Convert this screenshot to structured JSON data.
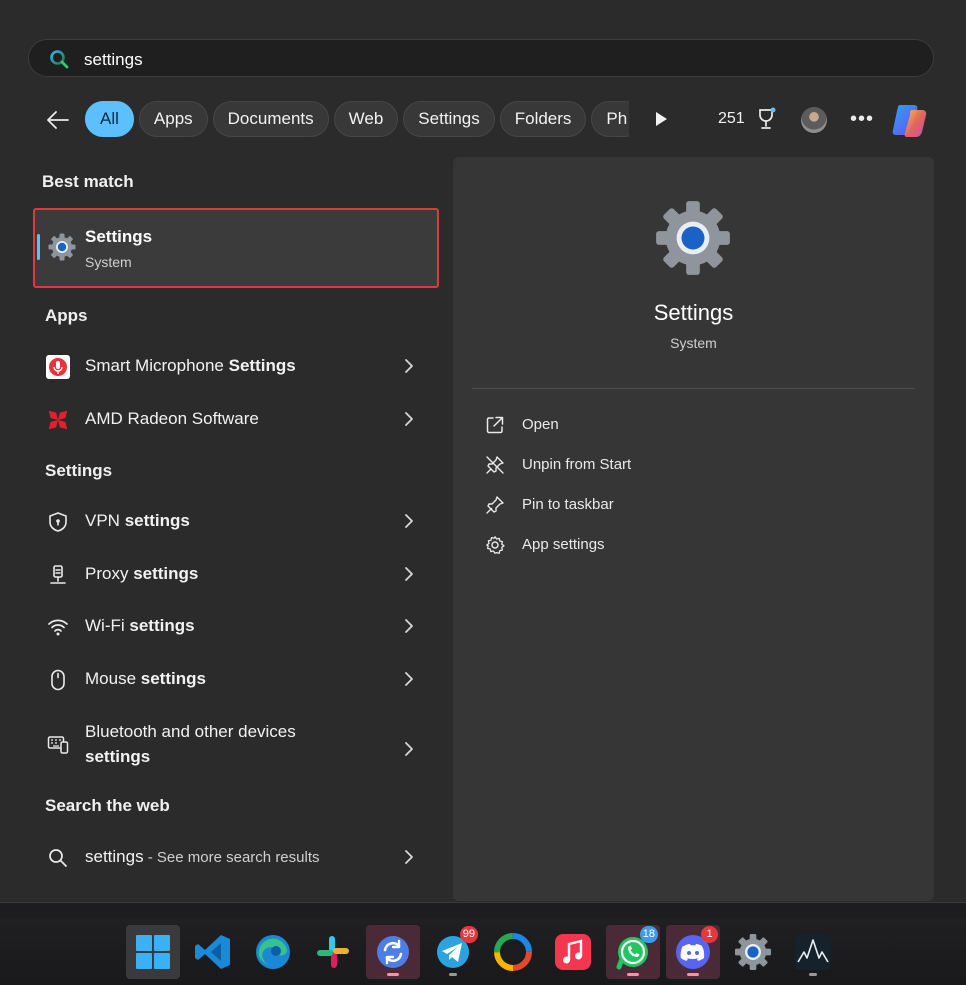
{
  "search": {
    "value": "settings",
    "placeholder": ""
  },
  "filters": [
    "All",
    "Apps",
    "Documents",
    "Web",
    "Settings",
    "Folders",
    "Ph"
  ],
  "header": {
    "points": "251",
    "more": "•••"
  },
  "best_match": {
    "heading": "Best match",
    "title": "Settings",
    "subtitle": "System"
  },
  "apps": {
    "heading": "Apps",
    "items": [
      {
        "label_pre": "Smart Microphone ",
        "label_bold": "Settings",
        "icon": "smart-microphone-app-icon"
      },
      {
        "label_pre": "AMD Radeon Software",
        "label_bold": "",
        "icon": "amd-radeon-app-icon"
      }
    ]
  },
  "settings": {
    "heading": "Settings",
    "items": [
      {
        "label_pre": "VPN ",
        "label_bold": "settings",
        "icon": "shield-icon"
      },
      {
        "label_pre": "Proxy ",
        "label_bold": "settings",
        "icon": "proxy-icon"
      },
      {
        "label_pre": "Wi-Fi ",
        "label_bold": "settings",
        "icon": "wifi-icon"
      },
      {
        "label_pre": "Mouse ",
        "label_bold": "settings",
        "icon": "mouse-icon"
      },
      {
        "label_pre": "Bluetooth and other devices",
        "label_bold": "settings",
        "icon": "devices-icon"
      }
    ]
  },
  "web": {
    "heading": "Search the web",
    "query": "settings",
    "hint": " - See more search results"
  },
  "preview": {
    "title": "Settings",
    "subtitle": "System",
    "actions": [
      {
        "label": "Open",
        "icon": "open-external-icon"
      },
      {
        "label": "Unpin from Start",
        "icon": "unpin-icon"
      },
      {
        "label": "Pin to taskbar",
        "icon": "pin-icon"
      },
      {
        "label": "App settings",
        "icon": "gear-icon"
      }
    ]
  },
  "taskbar": {
    "apps": [
      "windows-start",
      "vscode",
      "edge",
      "slack",
      "sync-app",
      "telegram",
      "photos",
      "apple-music",
      "whatsapp",
      "discord",
      "settings",
      "audio-app"
    ],
    "badges": {
      "telegram": "99",
      "whatsapp": "18",
      "discord": "1"
    }
  },
  "colors": {
    "accent": "#5cc0ff",
    "highlight_border": "#e0393e",
    "panel": "#2b2b2b",
    "preview": "#363636"
  }
}
